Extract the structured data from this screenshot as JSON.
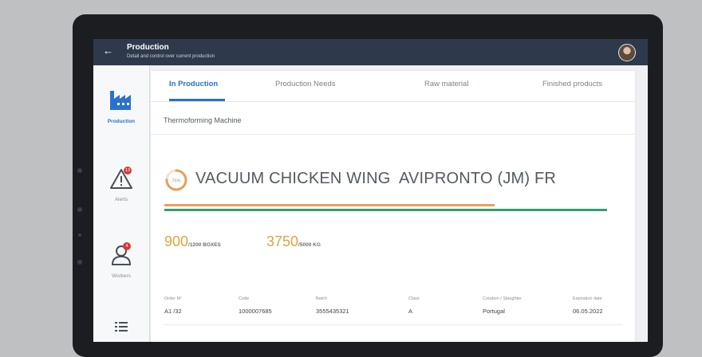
{
  "header": {
    "title": "Production",
    "subtitle": "Detail and control over current production"
  },
  "sidebar": {
    "items": [
      {
        "label": "Production",
        "icon": "factory-icon",
        "active": true
      },
      {
        "label": "Alerts",
        "icon": "warning-icon",
        "badge": "13"
      },
      {
        "label": "Workers",
        "icon": "worker-icon",
        "badge": "4"
      },
      {
        "label": "",
        "icon": "list-icon"
      }
    ]
  },
  "tabs": [
    {
      "label": "In Production",
      "active": true
    },
    {
      "label": "Production Needs"
    },
    {
      "label": "Raw material"
    },
    {
      "label": "Finished products"
    }
  ],
  "machine": "Thermoforming Machine",
  "product": {
    "name": "VACUUM CHICKEN WING  AVIPRONTO (JM) FR",
    "progress_label": "75%",
    "progress_fraction": 0.75,
    "quantities": [
      {
        "value": "900",
        "total": "/1200 BOXES"
      },
      {
        "value": "3750",
        "total": "/5000 KG"
      }
    ]
  },
  "details": [
    {
      "label": "Order Nº",
      "value": "A1 /32"
    },
    {
      "label": "Code",
      "value": "1000007685"
    },
    {
      "label": "Batch",
      "value": "3555435321"
    },
    {
      "label": "Class",
      "value": "A"
    },
    {
      "label": "Creation / Slaughter",
      "value": "Portugal"
    },
    {
      "label": "Expiration date",
      "value": "06.05.2022"
    }
  ],
  "colors": {
    "topbar": "#2e3a4b",
    "accent": "#2a6fc4",
    "progress_orange": "#e8a05a",
    "progress_green": "#2e9f6e",
    "quantity_gold": "#d7a741",
    "badge_red": "#d63a3a"
  }
}
